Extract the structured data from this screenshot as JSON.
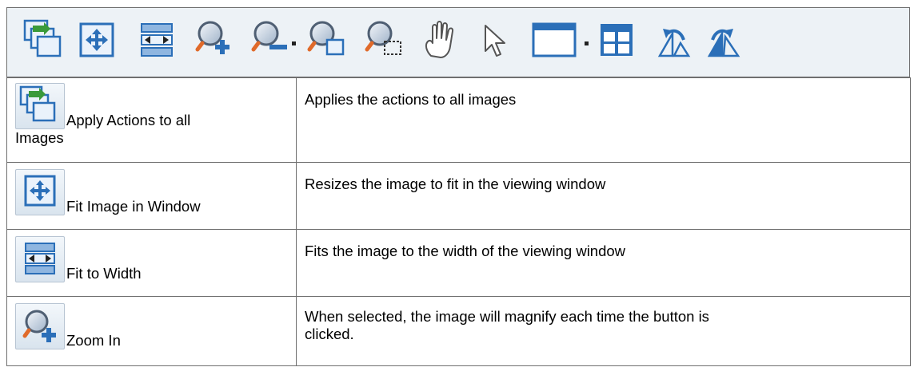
{
  "toolbar": {
    "icons": [
      "apply-actions-icon",
      "fit-window-icon",
      "fit-width-icon",
      "zoom-in-icon",
      "zoom-out-icon",
      "dropdown-icon",
      "zoom-window-icon",
      "zoom-selection-icon",
      "hand-pan-icon",
      "arrow-pointer-icon",
      "window-layout-icon",
      "dropdown-icon",
      "grid-layout-icon",
      "rotate-left-icon",
      "rotate-right-icon"
    ]
  },
  "rows": [
    {
      "label": "Apply Actions to all Images",
      "label_line1": "Apply Actions to all",
      "label_line2": "Images",
      "icon": "apply-actions-icon",
      "description": "Applies the actions to all images"
    },
    {
      "label": "Fit Image in Window",
      "icon": "fit-window-icon",
      "description": "Resizes the image to fit in the viewing window"
    },
    {
      "label": "Fit to Width",
      "icon": "fit-width-icon",
      "description": "Fits the image to the width of the viewing window"
    },
    {
      "label": "Zoom In",
      "icon": "zoom-in-icon",
      "description_line1": "When selected, the image will magnify each time the button is",
      "description_line2": "clicked.",
      "description": "When selected, the image will magnify each time the button is clicked."
    }
  ],
  "colors": {
    "icon_blue": "#2b6fb8",
    "icon_green": "#3a9a3a",
    "toolbar_bg": "#edf2f6",
    "border": "#6f6f6f"
  }
}
